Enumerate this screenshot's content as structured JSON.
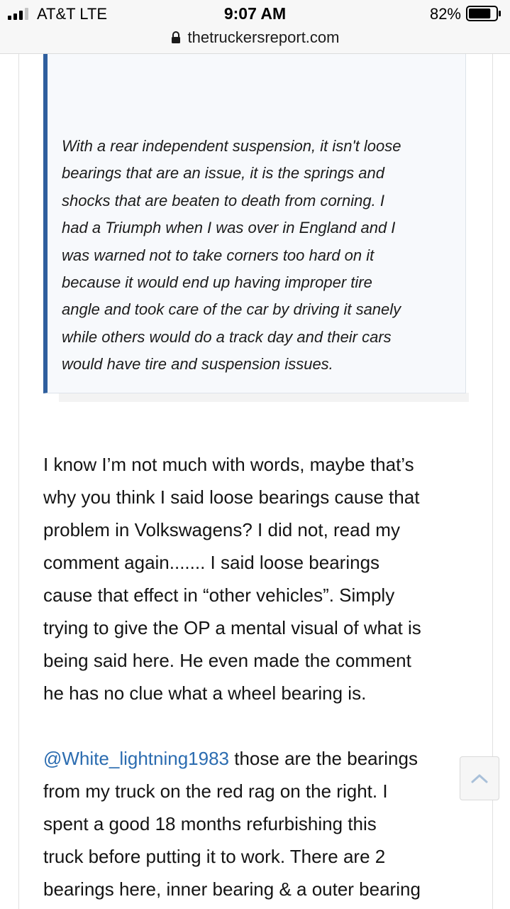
{
  "status_bar": {
    "carrier": "AT&T  LTE",
    "time": "9:07 AM",
    "battery_percent": "82%",
    "battery_level": 0.82,
    "signal_bars_filled": 3,
    "signal_bars_total": 4,
    "icons": [
      "signal-icon",
      "battery-icon"
    ]
  },
  "browser": {
    "url": "thetruckersreport.com",
    "lock_icon": "lock-icon"
  },
  "quote": {
    "lines": [
      "With a rear independent suspension, it isn't loose",
      "bearings that are an issue, it is the springs and",
      "shocks that are beaten to death from corning. I",
      "had a Triumph when I was over in England and I",
      "was warned not to take corners too hard on it",
      "because it would end up having improper tire",
      "angle and took care of the car by driving it sanely",
      "while others would do a track day and their cars",
      "would have tire and suspension issues."
    ]
  },
  "post": {
    "paragraph1_lines": [
      "I know I’m not much with words, maybe that’s",
      "why you think I said loose bearings cause that",
      "problem in Volkswagens? I did not, read my",
      "comment again....... I said loose bearings",
      "cause that effect in “other vehicles”. Simply",
      "trying to give the OP a mental visual of what is",
      "being said here. He even made the comment",
      "he has no clue what a wheel bearing is."
    ],
    "mention": "@White_lightning1983",
    "paragraph2_first_rest": " those are the bearings",
    "paragraph2_lines": [
      "from my truck on the red rag on the right. I",
      "spent a good 18 months refurbishing this",
      "truck before putting it to work. There are 2",
      "bearings here, inner bearing & a outer bearing"
    ]
  },
  "scroll_top": {
    "icon": "chevron-up-icon"
  },
  "colors": {
    "quote_border": "#2f5f9e",
    "quote_background": "#f7f9fc",
    "link": "#2b6cb0",
    "scroll_chevron": "#a9c0d9"
  }
}
